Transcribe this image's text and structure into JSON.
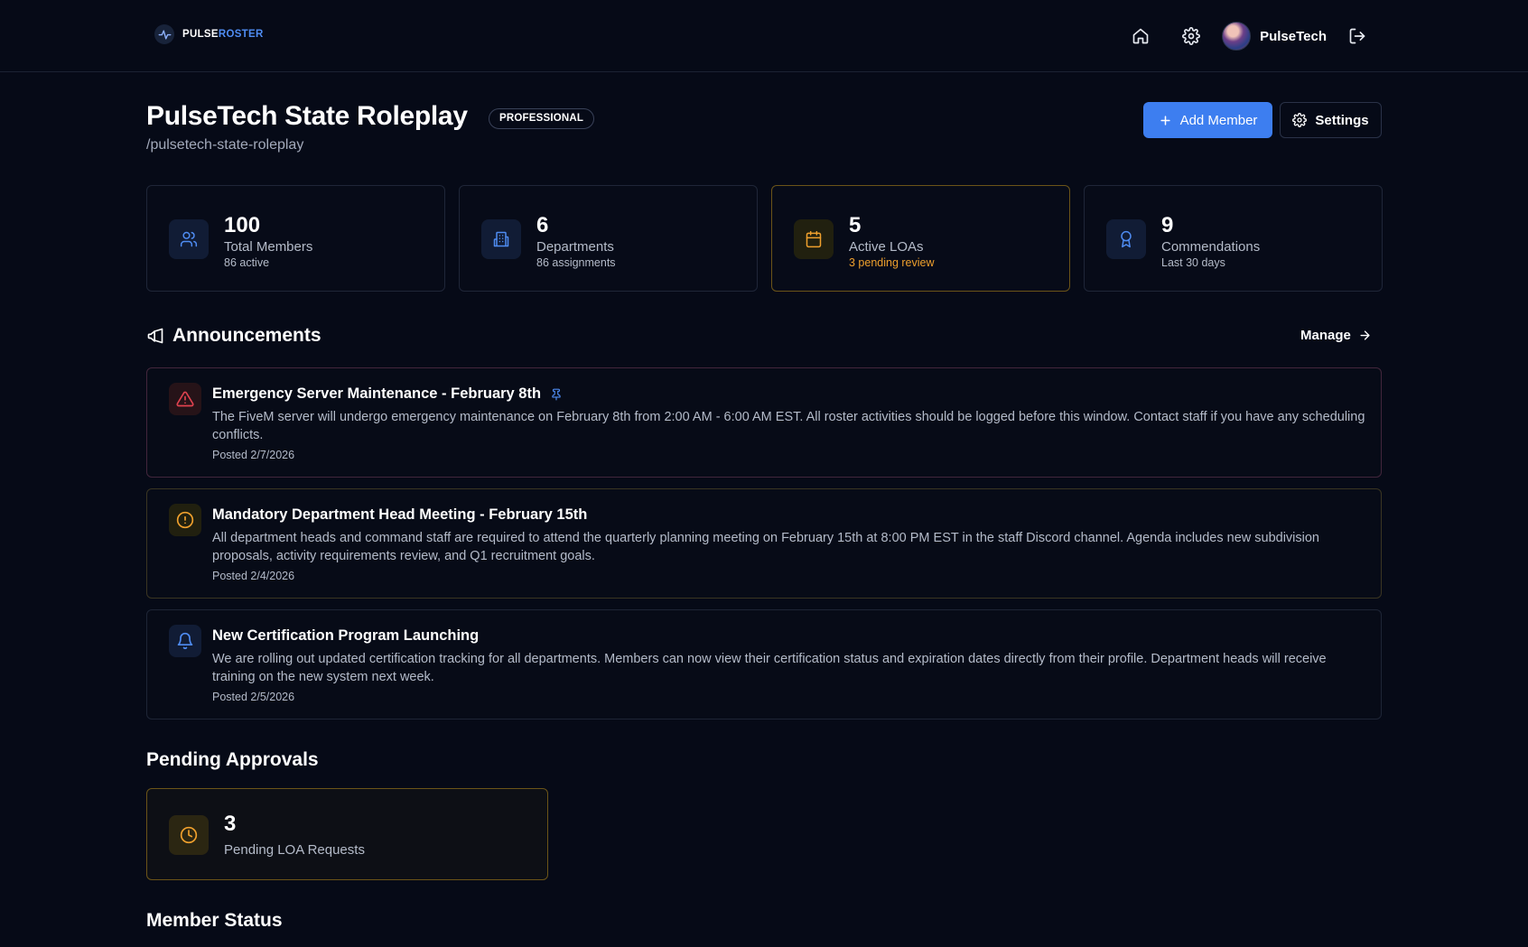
{
  "brand": {
    "part1": "PULSE",
    "part2": "ROSTER"
  },
  "nav": {
    "user_name": "PulseTech"
  },
  "header": {
    "title": "PulseTech State Roleplay",
    "plan_badge": "PROFESSIONAL",
    "slug": "/pulsetech-state-roleplay",
    "add_member_label": "Add Member",
    "settings_label": "Settings"
  },
  "stats": [
    {
      "value": "100",
      "label": "Total Members",
      "sub": "86 active",
      "icon": "users-icon"
    },
    {
      "value": "6",
      "label": "Departments",
      "sub": "86 assignments",
      "icon": "building-icon"
    },
    {
      "value": "5",
      "label": "Active LOAs",
      "sub": "3 pending review",
      "icon": "calendar-icon"
    },
    {
      "value": "9",
      "label": "Commendations",
      "sub": "Last 30 days",
      "icon": "award-icon"
    }
  ],
  "announcements": {
    "title": "Announcements",
    "manage_label": "Manage",
    "items": [
      {
        "title": "Emergency Server Maintenance - February 8th",
        "body": "The FiveM server will undergo emergency maintenance on February 8th from 2:00 AM - 6:00 AM EST. All roster activities should be logged before this window. Contact staff if you have any scheduling conflicts.",
        "date": "Posted 2/7/2026",
        "icon": "alert-triangle-icon",
        "pinned": true
      },
      {
        "title": "Mandatory Department Head Meeting - February 15th",
        "body": "All department heads and command staff are required to attend the quarterly planning meeting on February 15th at 8:00 PM EST in the staff Discord channel. Agenda includes new subdivision proposals, activity requirements review, and Q1 recruitment goals.",
        "date": "Posted 2/4/2026",
        "icon": "alert-circle-icon",
        "pinned": false
      },
      {
        "title": "New Certification Program Launching",
        "body": "We are rolling out updated certification tracking for all departments. Members can now view their certification status and expiration dates directly from their profile. Department heads will receive training on the new system next week.",
        "date": "Posted 2/5/2026",
        "icon": "bell-icon",
        "pinned": false
      }
    ]
  },
  "pending": {
    "title": "Pending Approvals",
    "value": "3",
    "label": "Pending LOA Requests"
  },
  "member_status": {
    "title": "Member Status"
  },
  "colors": {
    "background": "#060a17",
    "accent": "#3d7ef0",
    "warning": "#efa02d",
    "danger": "#e0424f"
  }
}
